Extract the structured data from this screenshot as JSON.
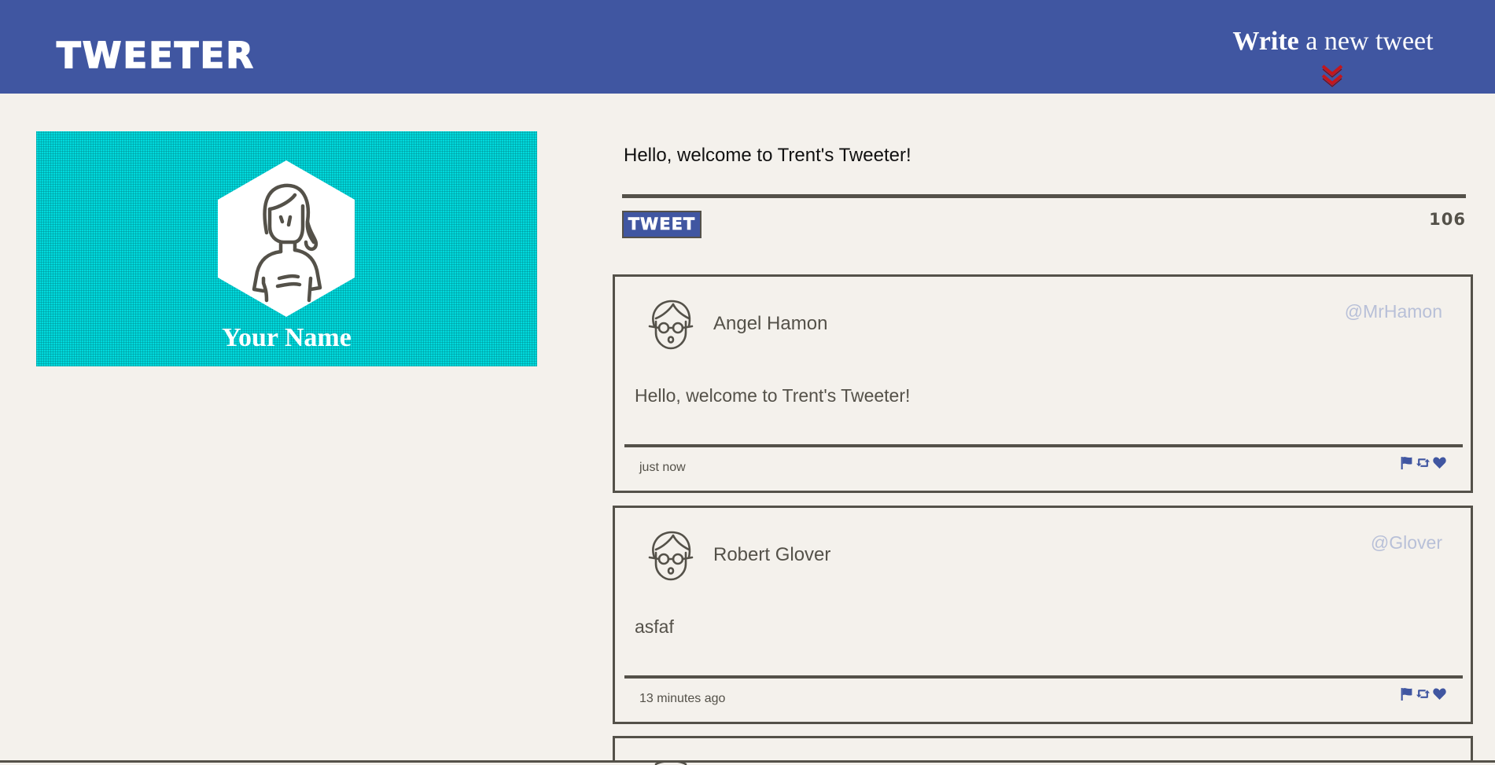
{
  "nav": {
    "brand": "TWEETER",
    "write_link_bold": "Write",
    "write_link_rest": " a new tweet",
    "brand_color": "#4056a1",
    "chevron_icon": "double-chevron-down-icon",
    "chevron_color": "#c4161c"
  },
  "profile": {
    "name": "Your Name",
    "avatar_icon": "woman-avatar-icon",
    "banner_color": "#00d9dc"
  },
  "composer": {
    "text": "Hello, welcome to Trent's Tweeter!",
    "button_label": "TWEET",
    "char_counter": "106"
  },
  "tweets": [
    {
      "user_name": "Angel Hamon",
      "handle": "@MrHamon",
      "content": "Hello, welcome to Trent's Tweeter!",
      "timestamp": "just now",
      "avatar_icon": "man-with-glasses-avatar-icon"
    },
    {
      "user_name": "Robert Glover",
      "handle": "@Glover",
      "content": "asfaf",
      "timestamp": "13 minutes ago",
      "avatar_icon": "man-with-glasses-avatar-icon"
    }
  ],
  "actions": {
    "flag_icon": "flag-icon",
    "retweet_icon": "retweet-icon",
    "like_icon": "heart-icon",
    "color": "#4056a1"
  }
}
